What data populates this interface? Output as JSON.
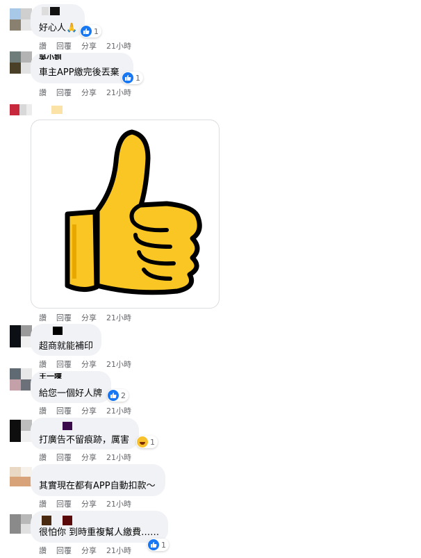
{
  "action_labels": {
    "like": "讚",
    "reply": "回覆",
    "share": "分享"
  },
  "comments": [
    {
      "text": "好心人🙏",
      "reaction": "like",
      "reaction_count": "1",
      "time": "21小時"
    },
    {
      "name": "吳小姐",
      "text": "車主APP繳完後丟棄",
      "reaction": "like",
      "reaction_count": "1",
      "time": "21小時"
    },
    {
      "text": "",
      "image": "thumbs-up-sticker",
      "time": "21小時"
    },
    {
      "text": "超商就能補印",
      "time": "21小時"
    },
    {
      "name": "王一陳",
      "text": "給您一個好人牌",
      "reaction": "like",
      "reaction_count": "2",
      "time": "21小時"
    },
    {
      "text": "打廣告不留痕跡，厲害",
      "reaction": "haha",
      "reaction_count": "1",
      "time": "21小時"
    },
    {
      "text": "其實現在都有APP自動扣款～",
      "time": "21小時"
    },
    {
      "text": "很怕你 到時重複幫人繳費……",
      "reaction": "like",
      "reaction_count": "1",
      "time": "21小時"
    }
  ],
  "colors": {
    "bubble": "#f0f2f5",
    "like": "#1877f2",
    "meta": "#65676b",
    "sticker_yellow": "#f9c623"
  }
}
